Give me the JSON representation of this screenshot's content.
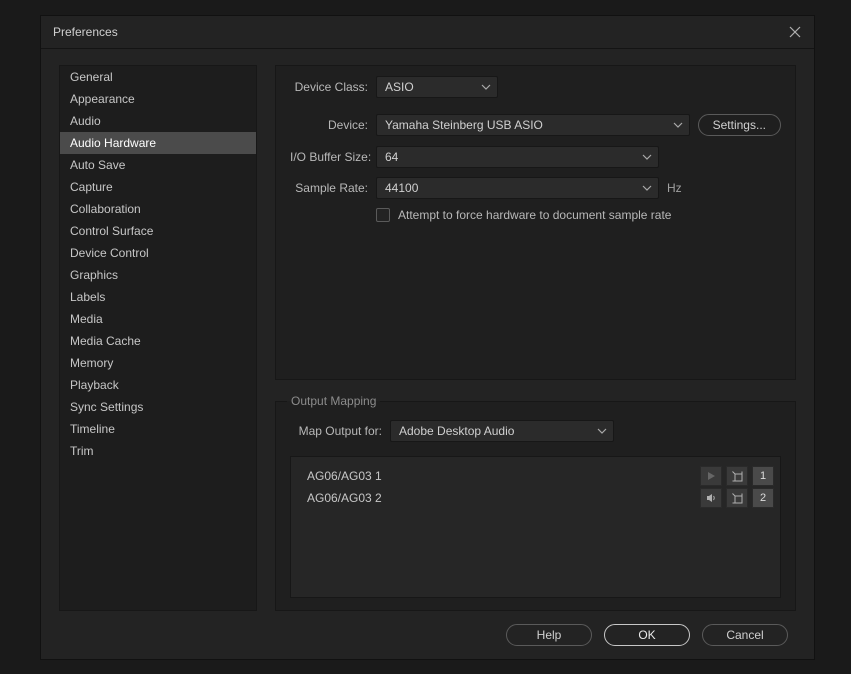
{
  "window": {
    "title": "Preferences"
  },
  "sidebar": {
    "items": [
      "General",
      "Appearance",
      "Audio",
      "Audio Hardware",
      "Auto Save",
      "Capture",
      "Collaboration",
      "Control Surface",
      "Device Control",
      "Graphics",
      "Labels",
      "Media",
      "Media Cache",
      "Memory",
      "Playback",
      "Sync Settings",
      "Timeline",
      "Trim"
    ],
    "selected_index": 3
  },
  "hardware": {
    "device_class_label": "Device Class:",
    "device_class_value": "ASIO",
    "device_label": "Device:",
    "device_value": "Yamaha Steinberg USB ASIO",
    "settings_button": "Settings...",
    "buffer_label": "I/O Buffer Size:",
    "buffer_value": "64",
    "sample_rate_label": "Sample Rate:",
    "sample_rate_value": "44100",
    "sample_rate_unit": "Hz",
    "force_checkbox_label": "Attempt to force hardware to document sample rate",
    "force_checked": false
  },
  "output_mapping": {
    "legend": "Output Mapping",
    "map_label": "Map Output for:",
    "map_value": "Adobe Desktop Audio",
    "rows": [
      {
        "name": "AG06/AG03 1",
        "number": "1",
        "muted": true
      },
      {
        "name": "AG06/AG03 2",
        "number": "2",
        "muted": false
      }
    ]
  },
  "footer": {
    "help": "Help",
    "ok": "OK",
    "cancel": "Cancel"
  }
}
